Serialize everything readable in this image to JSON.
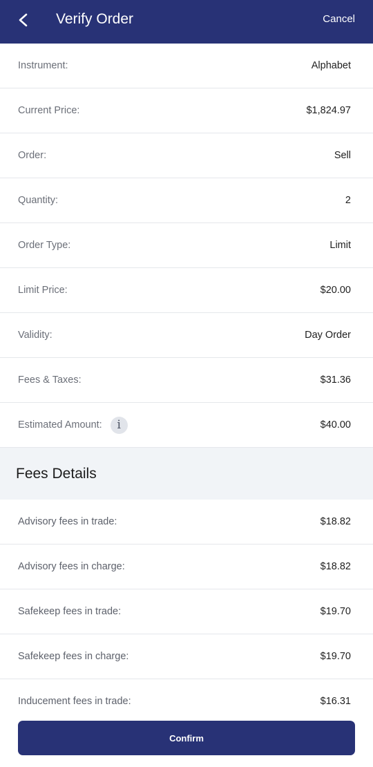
{
  "header": {
    "title": "Verify Order",
    "cancel_label": "Cancel"
  },
  "order": [
    {
      "label": "Instrument:",
      "value": "Alphabet"
    },
    {
      "label": "Current Price:",
      "value": "$1,824.97"
    },
    {
      "label": "Order:",
      "value": "Sell"
    },
    {
      "label": "Quantity:",
      "value": "2"
    },
    {
      "label": "Order Type:",
      "value": "Limit"
    },
    {
      "label": "Limit Price:",
      "value": "$20.00"
    },
    {
      "label": "Validity:",
      "value": "Day Order"
    },
    {
      "label": "Fees & Taxes:",
      "value": "$31.36"
    },
    {
      "label": "Estimated Amount:",
      "value": "$40.00",
      "info_icon": "i"
    }
  ],
  "fees_section": {
    "title": "Fees Details",
    "items": [
      {
        "label": "Advisory fees in trade:",
        "value": "$18.82"
      },
      {
        "label": "Advisory fees in charge:",
        "value": "$18.82"
      },
      {
        "label": "Safekeep fees in trade:",
        "value": "$19.70"
      },
      {
        "label": "Safekeep fees in charge:",
        "value": "$19.70"
      },
      {
        "label": "Inducement fees in trade:",
        "value": "$16.31"
      }
    ]
  },
  "footer": {
    "confirm_label": "Confirm"
  },
  "colors": {
    "brand": "#283276",
    "section_bg": "#f1f4f7",
    "divider": "#e5e7eb"
  }
}
